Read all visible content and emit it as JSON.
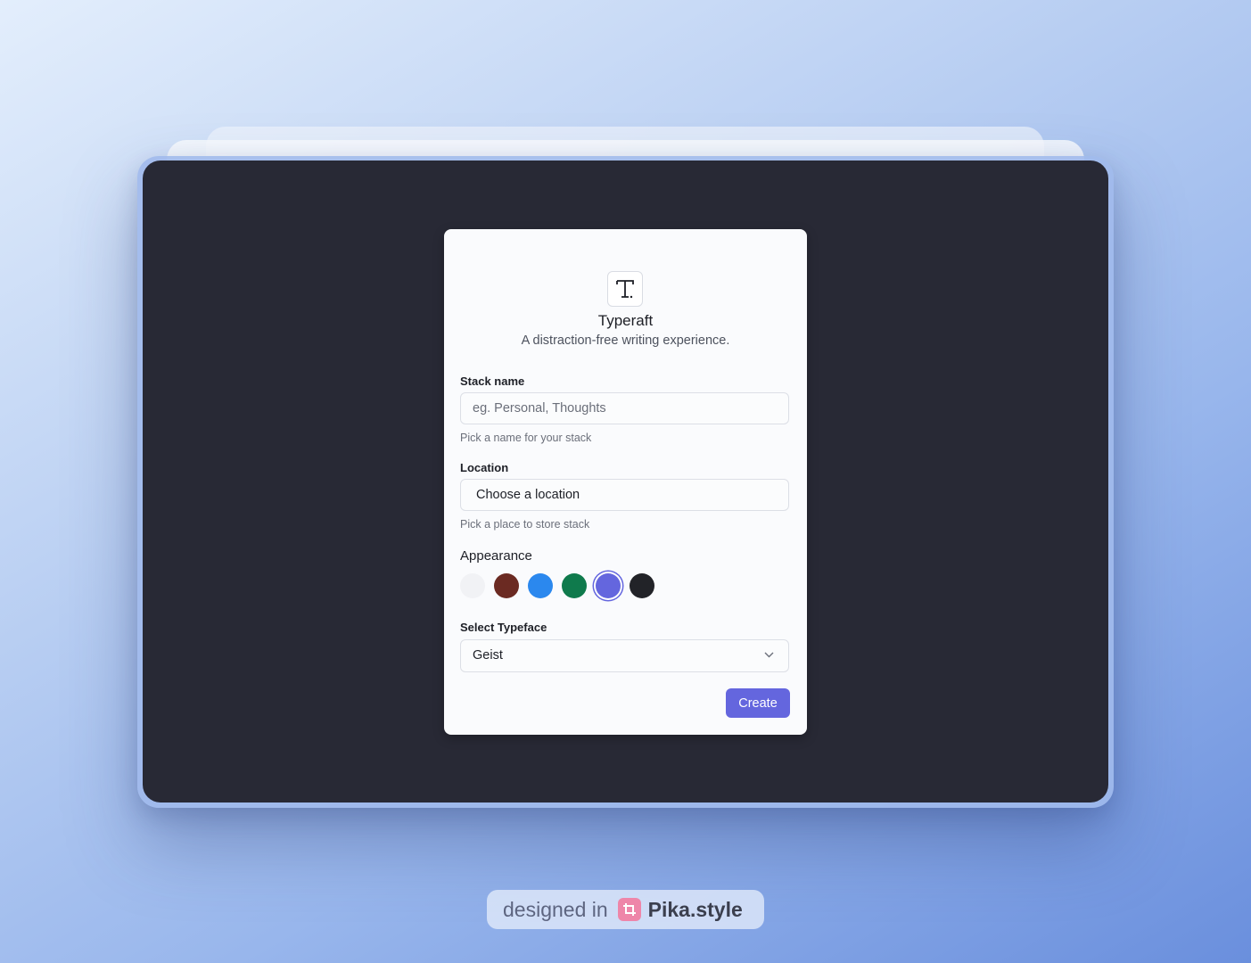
{
  "dialog": {
    "logo_icon": "typeface-t-icon",
    "title": "Typeraft",
    "subtitle": "A distraction-free writing experience.",
    "stack_name": {
      "label": "Stack name",
      "placeholder": "eg. Personal, Thoughts",
      "hint": "Pick a name for your stack"
    },
    "location": {
      "label": "Location",
      "value": "Choose a location",
      "hint": "Pick a place to store stack"
    },
    "appearance": {
      "label": "Appearance",
      "colors": [
        "#f1f2f5",
        "#6b2a22",
        "#2b88ee",
        "#0f7a4c",
        "#6466de",
        "#222328"
      ],
      "selected_index": 4
    },
    "typeface": {
      "label": "Select Typeface",
      "value": "Geist",
      "chevron_icon": "chevron-down-icon"
    },
    "create_label": "Create"
  },
  "badge": {
    "prefix": "designed in",
    "brand": "Pika.style",
    "logo_icon": "crop-icon"
  },
  "colors": {
    "window_bg": "#282935",
    "accent": "#6466de",
    "dialog_bg": "#fafbfd"
  }
}
